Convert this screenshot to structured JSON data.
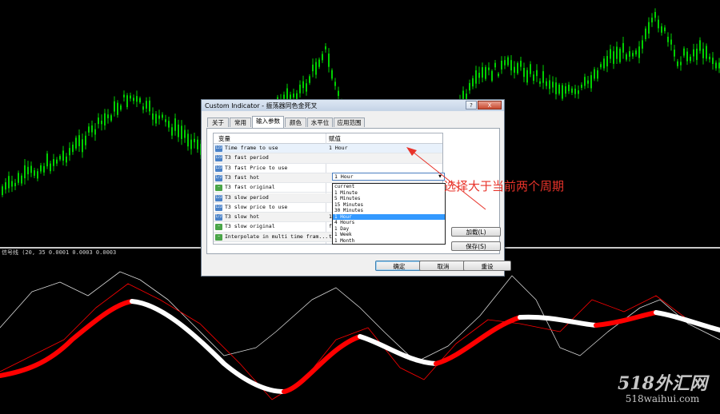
{
  "indicator_label": "信号线 (20, 35 0.0001 0.0003 0.0003",
  "dialog": {
    "title": "Custom Indicator - 振荡器同色金死叉",
    "help_glyph": "?",
    "close_glyph": "X",
    "tabs": [
      "关于",
      "常用",
      "输入参数",
      "颜色",
      "水平位",
      "应用范围"
    ],
    "active_tab": "输入参数",
    "columns": {
      "variable": "变量",
      "value": "赋值"
    },
    "rows": [
      {
        "icon": "123",
        "name": "Time frame to use",
        "value": "1 Hour"
      },
      {
        "icon": "123",
        "name": "T3 fast period",
        "value": ""
      },
      {
        "icon": "123",
        "name": "T3 fast Price to use",
        "value": ""
      },
      {
        "icon": "1/2",
        "name": "T3 fast hot",
        "value": ""
      },
      {
        "icon": "~",
        "name": "T3 fast original",
        "value": ""
      },
      {
        "icon": "123",
        "name": "T3 slow period",
        "value": ""
      },
      {
        "icon": "123",
        "name": "T3 slow price to use",
        "value": ""
      },
      {
        "icon": "1/2",
        "name": "T3 slow hot",
        "value": "1.2"
      },
      {
        "icon": "~",
        "name": "T3 slow original",
        "value": "false"
      },
      {
        "icon": "~",
        "name": "Interpolate in multi time fram...",
        "value": "true"
      }
    ],
    "combo": {
      "value": "1 Hour",
      "arrow": "▼"
    },
    "dropdown_options": [
      "current",
      "1 Minute",
      "5 Minutes",
      "15 Minutes",
      "30 Minutes",
      "1 Hour",
      "4 Hours",
      "1 Day",
      "1 Week",
      "1 Month"
    ],
    "dropdown_selected": "1 Hour",
    "buttons": {
      "load": "加载(L)",
      "save": "保存(S)",
      "ok": "确定",
      "cancel": "取消",
      "reset": "重设"
    }
  },
  "annotation": "选择大于当前两个周期",
  "watermark": {
    "line1": "518外汇网",
    "line2": "518waihui.com"
  },
  "colors": {
    "candles": "#00d000",
    "signal_red": "#ff0000",
    "signal_white": "#ffffff",
    "thin_line": "#d8d8d8",
    "annotation": "#e8332a"
  }
}
